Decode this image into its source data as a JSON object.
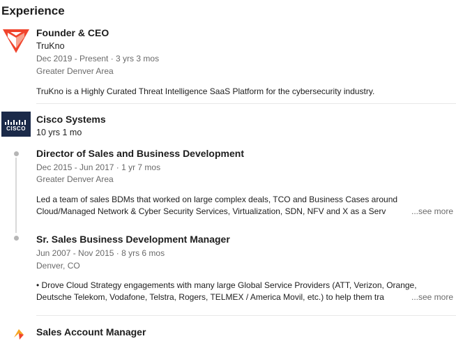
{
  "section": {
    "title": "Experience"
  },
  "experiences": [
    {
      "title": "Founder & CEO",
      "company": "TruKno",
      "dates": "Dec 2019 - Present · 3 yrs 3 mos",
      "location": "Greater Denver Area",
      "description": "TruKno is a Highly Curated Threat Intelligence SaaS Platform for the cybersecurity industry."
    },
    {
      "company": "Cisco Systems",
      "duration": "10 yrs 1 mo",
      "logo_text": "CISCO",
      "roles": [
        {
          "title": "Director of Sales and Business Development",
          "dates": "Dec 2015 - Jun 2017 · 1 yr 7 mos",
          "location": "Greater Denver Area",
          "description_line1": "Led a team of sales BDMs that worked on large complex deals, TCO and Business Cases around",
          "description_line2": "Cloud/Managed Network & Cyber Security Services, Virtualization, SDN, NFV and X as a Serv",
          "see_more": "...see more"
        },
        {
          "title": "Sr. Sales Business Development Manager",
          "dates": "Jun 2007 - Nov 2015 · 8 yrs 6 mos",
          "location": "Denver, CO",
          "description_line1": "• Drove Cloud Strategy engagements with many large Global Service Providers (ATT, Verizon, Orange,",
          "description_line2": "Deutsche Telekom, Vodafone, Telstra, Rogers, TELMEX / America Movil, etc.) to help them tra",
          "see_more": "...see more"
        }
      ]
    },
    {
      "title": "Sales Account Manager"
    }
  ],
  "colors": {
    "trukno_logo": "#f0442c",
    "cisco_logo_bg": "#1b2a49",
    "timeline": "#d9d9d9",
    "muted_text": "#6b6b6b"
  }
}
